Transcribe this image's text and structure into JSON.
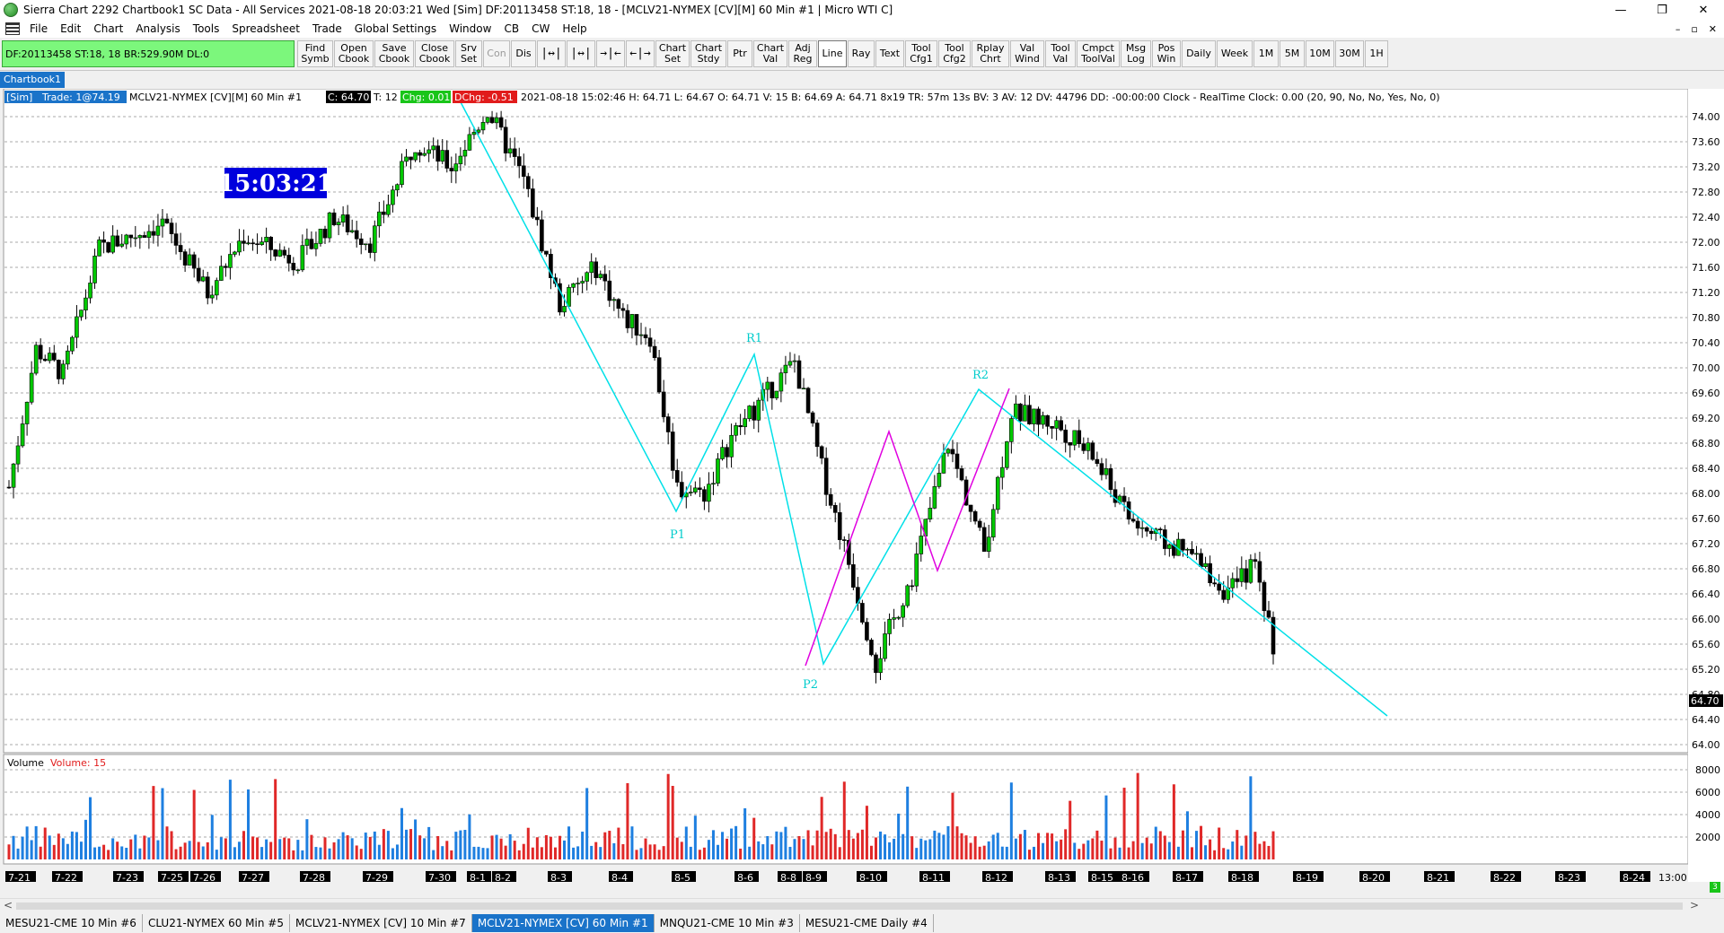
{
  "window": {
    "title": "Sierra Chart 2292 Chartbook1  SC Data - All Services 2021-08-18  20:03:21 Wed [Sim]  DF:20113458  ST:18, 18 - [MCLV21-NYMEX [CV][M]  60 Min  #1 | Micro WTI C]",
    "minimize": "—",
    "restore": "❐",
    "close": "✕"
  },
  "menu": {
    "items": [
      "File",
      "Edit",
      "Chart",
      "Analysis",
      "Tools",
      "Spreadsheet",
      "Trade",
      "Global Settings",
      "Window",
      "CB",
      "CW",
      "Help"
    ],
    "right": [
      "–",
      "▫",
      "✕"
    ]
  },
  "toolbar": {
    "status": "DF:20113458  ST:18, 18  BR:529.90M  DL:0",
    "buttons": [
      {
        "label": "Find\nSymb",
        "w": 36
      },
      {
        "label": "Open\nCbook",
        "w": 40
      },
      {
        "label": "Save\nCbook",
        "w": 40
      },
      {
        "label": "Close\nCbook",
        "w": 40
      },
      {
        "label": "Srv\nSet",
        "w": 26
      },
      {
        "label": "Con",
        "w": 26,
        "disabled": true
      },
      {
        "label": "Dis",
        "w": 24
      },
      {
        "label": "|↔|",
        "w": 28,
        "icon": true
      },
      {
        "label": "|↔|",
        "w": 28,
        "icon": true
      },
      {
        "label": "→|←",
        "w": 28,
        "icon": true
      },
      {
        "label": "←|→",
        "w": 28,
        "icon": true
      },
      {
        "label": "Chart\nSet",
        "w": 34
      },
      {
        "label": "Chart\nStdy",
        "w": 36
      },
      {
        "label": "Ptr",
        "w": 24
      },
      {
        "label": "Chart\nVal",
        "w": 34
      },
      {
        "label": "Adj\nReg",
        "w": 28
      },
      {
        "label": "Line",
        "w": 28,
        "active": true
      },
      {
        "label": "Ray",
        "w": 26
      },
      {
        "label": "Text",
        "w": 28
      },
      {
        "label": "Tool\nCfg1",
        "w": 32
      },
      {
        "label": "Tool\nCfg2",
        "w": 32
      },
      {
        "label": "Rplay\nChrt",
        "w": 38
      },
      {
        "label": "Val\nWind",
        "w": 34
      },
      {
        "label": "Tool\nVal",
        "w": 30
      },
      {
        "label": "Cmpct\nToolVal",
        "w": 44
      },
      {
        "label": "Msg\nLog",
        "w": 30
      },
      {
        "label": "Pos\nWin",
        "w": 28
      },
      {
        "label": "Daily",
        "w": 34
      },
      {
        "label": "Week",
        "w": 36
      },
      {
        "label": "1M",
        "w": 24
      },
      {
        "label": "5M",
        "w": 24
      },
      {
        "label": "10M",
        "w": 28
      },
      {
        "label": "30M",
        "w": 28
      },
      {
        "label": "1H",
        "w": 22
      }
    ]
  },
  "chartbook_tab": "Chartbook1",
  "header": {
    "sim": "[Sim]",
    "trade": "Trade: 1@74.19",
    "symbol": "MCLV21-NYMEX [CV][M]  60 Min   #1",
    "close": "C: 64.70",
    "t": "T: 12",
    "chg": "Chg: 0.01",
    "dchg": "DChg: -0.51",
    "rest": "2021-08-18 15:02:46 H: 64.71 L: 64.67 O: 64.71 V: 15 B: 64.69 A: 64.71 8x19 TR: 57m 13s BV: 3 AV: 12 DV: 44796 DD: -00:00:00 Clock - RealTime  Clock: 0.00   (20, 90, No, No, Yes, No, 0)"
  },
  "clock": "15:03:21",
  "price_axis": [
    "74.00",
    "73.60",
    "73.20",
    "72.80",
    "72.40",
    "72.00",
    "71.60",
    "71.20",
    "70.80",
    "70.40",
    "70.00",
    "69.60",
    "69.20",
    "68.80",
    "68.40",
    "68.00",
    "67.60",
    "67.20",
    "66.80",
    "66.40",
    "66.00",
    "65.60",
    "65.20",
    "64.80",
    "64.40",
    "64.00"
  ],
  "last_price": "64.70",
  "volume_panel": {
    "title": "Volume",
    "value": "Volume: 15",
    "axis": [
      "8000",
      "6000",
      "4000",
      "2000"
    ]
  },
  "date_axis": [
    "7-21",
    "7-22",
    "7-23",
    "7-25",
    "7-26",
    "7-27",
    "7-28",
    "7-29",
    "7-30",
    "8-1",
    "8-2",
    "8-3",
    "8-4",
    "8-5",
    "8-6",
    "8-8",
    "8-9",
    "8-10",
    "8-11",
    "8-12",
    "8-13",
    "8-15",
    "8-16",
    "8-17",
    "8-18",
    "8-19",
    "8-20",
    "8-21",
    "8-22",
    "8-23",
    "8-24",
    "13:00"
  ],
  "annotations": {
    "p1": "P1",
    "r1": "R1",
    "p2": "P2",
    "r2": "R2"
  },
  "bottom_tabs": [
    {
      "label": "MESU21-CME  10 Min  #6"
    },
    {
      "label": "CLU21-NYMEX  60 Min  #5"
    },
    {
      "label": "MCLV21-NYMEX [CV]  10 Min  #7"
    },
    {
      "label": "MCLV21-NYMEX [CV]  60 Min  #1",
      "active": true
    },
    {
      "label": "MNQU21-CME  10 Min  #3"
    },
    {
      "label": "MESU21-CME  Daily  #4"
    }
  ],
  "scroll": {
    "left": "<",
    "right": ">"
  },
  "mini_badge": "3",
  "chart_data": {
    "type": "candlestick",
    "symbol": "MCLV21-NYMEX [CV][M]",
    "interval": "60 Min",
    "ylim": [
      64.0,
      74.2
    ],
    "anchors": [
      [
        0,
        68.1
      ],
      [
        6,
        70.3
      ],
      [
        12,
        69.9
      ],
      [
        20,
        71.9
      ],
      [
        34,
        72.3
      ],
      [
        44,
        71.2
      ],
      [
        52,
        72.1
      ],
      [
        64,
        71.7
      ],
      [
        72,
        72.4
      ],
      [
        80,
        72.0
      ],
      [
        90,
        73.6
      ],
      [
        98,
        73.2
      ],
      [
        106,
        74.1
      ],
      [
        114,
        73.0
      ],
      [
        122,
        71.0
      ],
      [
        130,
        71.6
      ],
      [
        136,
        70.8
      ],
      [
        142,
        70.5
      ],
      [
        148,
        68.1
      ],
      [
        154,
        68.0
      ],
      [
        160,
        68.9
      ],
      [
        168,
        69.6
      ],
      [
        174,
        70.1
      ],
      [
        180,
        68.4
      ],
      [
        186,
        66.9
      ],
      [
        192,
        65.3
      ],
      [
        200,
        66.7
      ],
      [
        208,
        68.8
      ],
      [
        216,
        67.1
      ],
      [
        222,
        69.3
      ],
      [
        232,
        69.1
      ],
      [
        240,
        68.6
      ],
      [
        248,
        67.6
      ],
      [
        256,
        67.2
      ],
      [
        262,
        67.0
      ],
      [
        270,
        66.4
      ],
      [
        276,
        66.9
      ],
      [
        280,
        65.6
      ]
    ]
  }
}
